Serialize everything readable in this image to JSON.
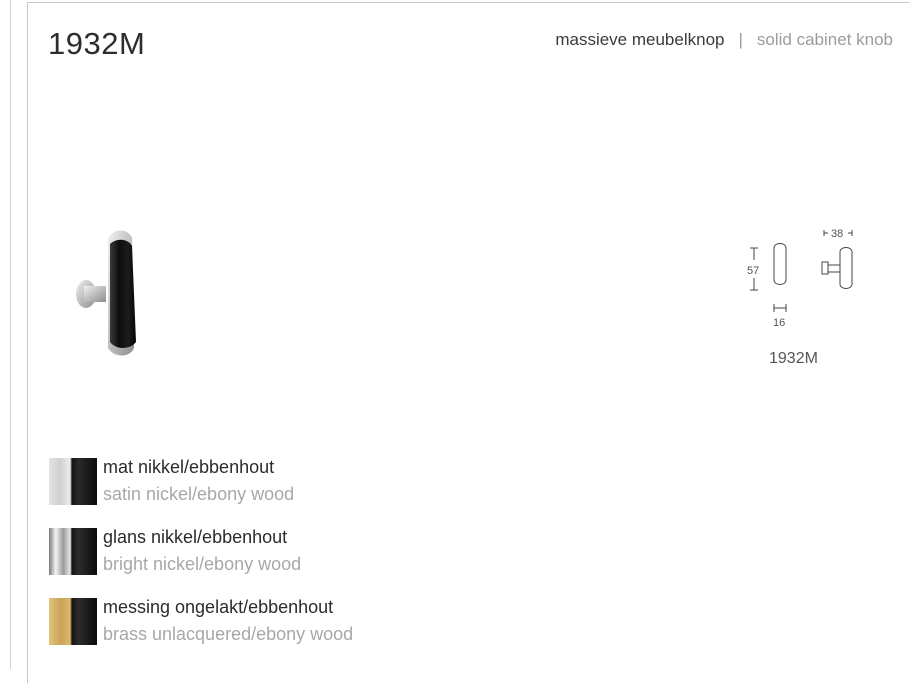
{
  "product": {
    "code": "1932M",
    "description_nl": "massieve meubelknop",
    "separator": "|",
    "description_en": "solid cabinet knob"
  },
  "drawing": {
    "caption": "1932M",
    "dim_height": "57",
    "dim_width": "16",
    "dim_depth": "38"
  },
  "finishes": [
    {
      "name_nl": "mat nikkel/ebbenhout",
      "name_en": "satin nickel/ebony wood",
      "swatch": "satin-nickel-ebony",
      "colors": [
        "#d9d9d9",
        "#1a1a1a"
      ]
    },
    {
      "name_nl": "glans nikkel/ebbenhout",
      "name_en": "bright nickel/ebony wood",
      "swatch": "bright-nickel-ebony",
      "colors": [
        "#c8c8c8",
        "#1a1a1a"
      ]
    },
    {
      "name_nl": "messing ongelakt/ebbenhout",
      "name_en": "brass unlacquered/ebony wood",
      "swatch": "brass-ebony",
      "colors": [
        "#d8b468",
        "#1a1a1a"
      ]
    }
  ]
}
